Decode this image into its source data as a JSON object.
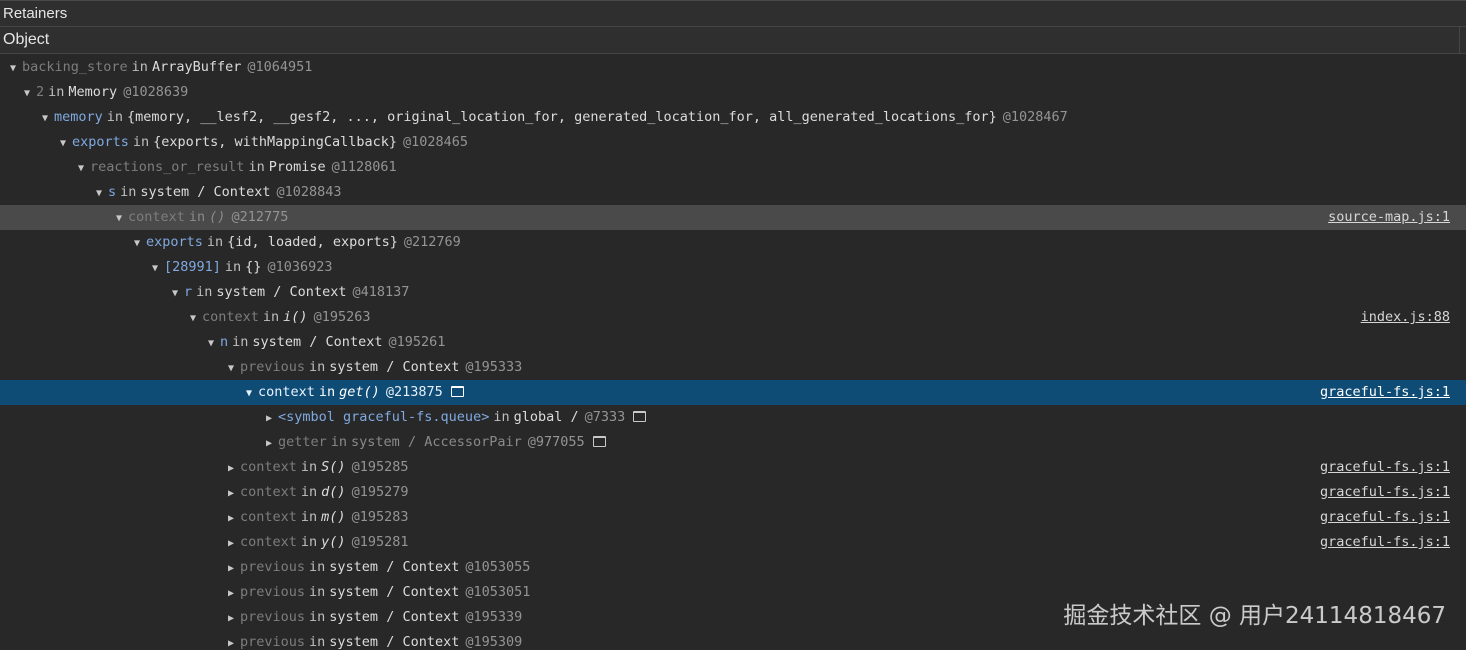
{
  "panel": {
    "title": "Retainers",
    "column": "Object"
  },
  "rows": [
    {
      "name": "backing_store",
      "kw": "in",
      "obj": "ArrayBuffer",
      "id": "@1064951"
    },
    {
      "name": "2",
      "kw": "in",
      "obj": "Memory",
      "id": "@1028639"
    },
    {
      "name": "memory",
      "kw": "in",
      "obj": "{memory, __lesf2, __gesf2, ..., original_location_for, generated_location_for, all_generated_locations_for}",
      "id": "@1028467"
    },
    {
      "name": "exports",
      "kw": "in",
      "obj": "{exports, withMappingCallback}",
      "id": "@1028465"
    },
    {
      "name": "reactions_or_result",
      "kw": "in",
      "obj": "Promise",
      "id": "@1128061"
    },
    {
      "name": "s",
      "kw": "in",
      "obj": "system / Context",
      "id": "@1028843"
    },
    {
      "name": "context",
      "kw": "in",
      "obj": "()",
      "id": "@212775",
      "link": "source-map.js:1"
    },
    {
      "name": "exports",
      "kw": "in",
      "obj": "{id, loaded, exports}",
      "id": "@212769"
    },
    {
      "name": "[28991]",
      "kw": "in",
      "obj": "{}",
      "id": "@1036923"
    },
    {
      "name": "r",
      "kw": "in",
      "obj": "system / Context",
      "id": "@418137"
    },
    {
      "name": "context",
      "kw": "in",
      "obj": "i()",
      "id": "@195263",
      "link": "index.js:88"
    },
    {
      "name": "n",
      "kw": "in",
      "obj": "system / Context",
      "id": "@195261"
    },
    {
      "name": "previous",
      "kw": "in",
      "obj": "system / Context",
      "id": "@195333"
    },
    {
      "name": "context",
      "kw": "in",
      "obj": "get()",
      "id": "@213875",
      "link": "graceful-fs.js:1"
    },
    {
      "name": "<symbol graceful-fs.queue>",
      "kw": "in",
      "obj": "global /",
      "id": "@7333"
    },
    {
      "name": "getter",
      "kw": "in",
      "obj": "system / AccessorPair",
      "id": "@977055"
    },
    {
      "name": "context",
      "kw": "in",
      "obj": "S()",
      "id": "@195285",
      "link": "graceful-fs.js:1"
    },
    {
      "name": "context",
      "kw": "in",
      "obj": "d()",
      "id": "@195279",
      "link": "graceful-fs.js:1"
    },
    {
      "name": "context",
      "kw": "in",
      "obj": "m()",
      "id": "@195283",
      "link": "graceful-fs.js:1"
    },
    {
      "name": "context",
      "kw": "in",
      "obj": "y()",
      "id": "@195281",
      "link": "graceful-fs.js:1"
    },
    {
      "name": "previous",
      "kw": "in",
      "obj": "system / Context",
      "id": "@1053055"
    },
    {
      "name": "previous",
      "kw": "in",
      "obj": "system / Context",
      "id": "@1053051"
    },
    {
      "name": "previous",
      "kw": "in",
      "obj": "system / Context",
      "id": "@195339"
    },
    {
      "name": "previous",
      "kw": "in",
      "obj": "system / Context",
      "id": "@195309"
    }
  ],
  "watermark": "掘金技术社区 @ 用户24114818467",
  "colors": {
    "selected": "#0f4c75",
    "hover": "#4a4a4a",
    "background": "#282828"
  }
}
